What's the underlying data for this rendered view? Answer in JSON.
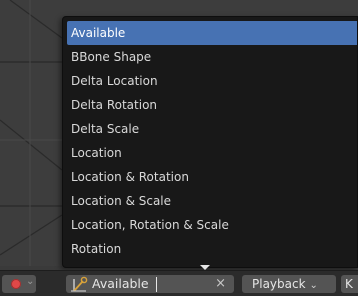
{
  "menu": {
    "items": [
      {
        "label": "Available",
        "selected": true
      },
      {
        "label": "BBone Shape"
      },
      {
        "label": "Delta Location"
      },
      {
        "label": "Delta Rotation"
      },
      {
        "label": "Delta Scale"
      },
      {
        "label": "Location"
      },
      {
        "label": "Location & Rotation"
      },
      {
        "label": "Location & Scale"
      },
      {
        "label": "Location, Rotation & Scale"
      },
      {
        "label": "Rotation"
      }
    ],
    "scroll_more_icon": "triangle-down-icon"
  },
  "footer": {
    "record_icon": "record-dot-icon",
    "record_caret": "⌄",
    "keying_set": {
      "icon": "keying-set-icon",
      "value": "Available",
      "clear_icon": "×"
    },
    "playback_label": "Playback",
    "playback_caret": "⌄",
    "keying_label": "K"
  },
  "colors": {
    "menu_bg": "#181818",
    "selected": "#4772b3",
    "text": "#d9d9d9",
    "footer_bg": "#2b2b2b",
    "field_bg": "#545454",
    "record": "#e04848",
    "keying_icon": "#d8a23a"
  }
}
